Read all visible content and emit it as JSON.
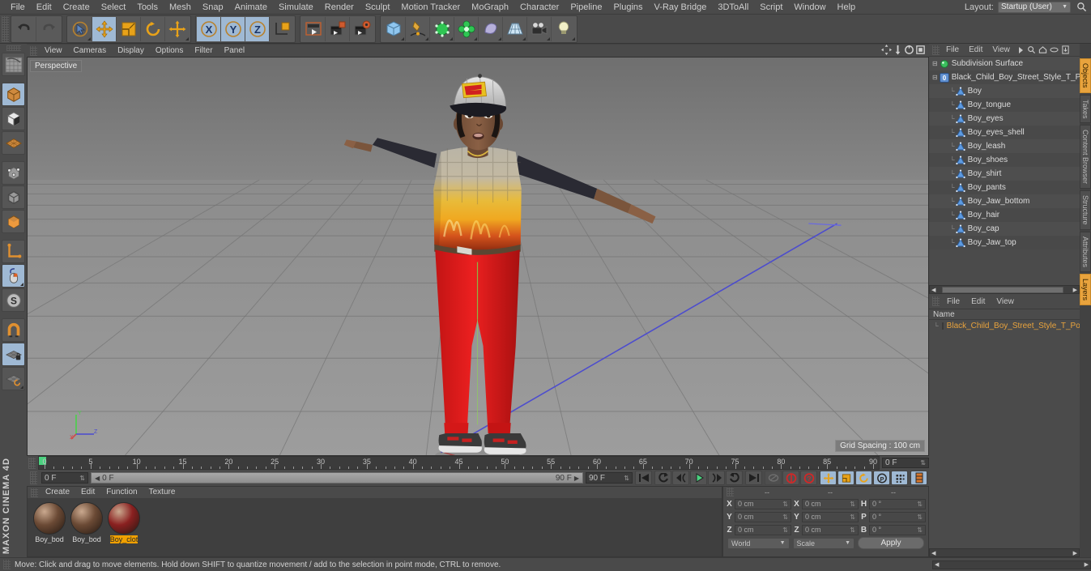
{
  "menubar": {
    "items": [
      "File",
      "Edit",
      "Create",
      "Select",
      "Tools",
      "Mesh",
      "Snap",
      "Animate",
      "Simulate",
      "Render",
      "Sculpt",
      "Motion Tracker",
      "MoGraph",
      "Character",
      "Pipeline",
      "Plugins",
      "V-Ray Bridge",
      "3DToAll",
      "Script",
      "Window",
      "Help"
    ],
    "layout_label": "Layout:",
    "layout_value": "Startup (User)",
    "search_icon": "search-icon"
  },
  "toolbar": {
    "groups": [
      {
        "name": "history",
        "buttons": [
          {
            "name": "undo-button",
            "icon": "undo-icon",
            "state": "normal"
          },
          {
            "name": "redo-button",
            "icon": "redo-icon",
            "state": "disabled"
          }
        ]
      },
      {
        "name": "tools",
        "buttons": [
          {
            "name": "select-tool",
            "icon": "cursor-select-icon",
            "state": "normal"
          },
          {
            "name": "move-tool",
            "icon": "move-arrows-icon",
            "state": "active"
          },
          {
            "name": "scale-tool",
            "icon": "scale-box-icon",
            "state": "normal"
          },
          {
            "name": "rotate-tool",
            "icon": "rotate-circle-icon",
            "state": "normal"
          },
          {
            "name": "combined-tool",
            "icon": "move-plus-icon",
            "state": "normal"
          }
        ]
      },
      {
        "name": "axis-locks",
        "buttons": [
          {
            "name": "lock-x-axis",
            "icon": "x-axis-icon",
            "state": "normal"
          },
          {
            "name": "lock-y-axis",
            "icon": "y-axis-icon",
            "state": "normal"
          },
          {
            "name": "lock-z-axis",
            "icon": "z-axis-icon",
            "state": "normal"
          },
          {
            "name": "world-object-coords",
            "icon": "world-coordinate-icon",
            "state": "normal"
          }
        ]
      },
      {
        "name": "render",
        "buttons": [
          {
            "name": "render-view-button",
            "icon": "render-view-icon",
            "state": "normal"
          },
          {
            "name": "render-to-picture-viewer-button",
            "icon": "render-picture-viewer-icon",
            "state": "normal"
          },
          {
            "name": "render-settings-button",
            "icon": "render-settings-icon",
            "state": "normal"
          }
        ]
      },
      {
        "name": "objects",
        "buttons": [
          {
            "name": "add-cube-button",
            "icon": "cube-icon",
            "state": "normal"
          },
          {
            "name": "add-spline-button",
            "icon": "pen-spline-icon",
            "state": "normal"
          },
          {
            "name": "generators-button",
            "icon": "generator-cube-icon",
            "state": "normal"
          },
          {
            "name": "deformers-button",
            "icon": "deformer-icon",
            "state": "normal"
          },
          {
            "name": "scene-object-button",
            "icon": "environment-icon",
            "state": "normal"
          },
          {
            "name": "floor-object-button",
            "icon": "floor-grid-icon",
            "state": "normal"
          },
          {
            "name": "camera-button",
            "icon": "camera-icon",
            "state": "normal"
          },
          {
            "name": "light-button",
            "icon": "light-bulb-icon",
            "state": "normal"
          }
        ]
      }
    ]
  },
  "leftbar": {
    "buttons": [
      {
        "name": "render-region-tool",
        "icon": "render-region-icon",
        "state": "normal"
      },
      {
        "name": "model-mode",
        "icon": "model-cube-icon",
        "state": "active"
      },
      {
        "name": "texture-mode",
        "icon": "texture-cube-icon",
        "state": "normal"
      },
      {
        "name": "workplane-mode",
        "icon": "workplane-icon",
        "state": "normal"
      },
      {
        "name": "point-mode",
        "icon": "point-mode-icon",
        "state": "normal"
      },
      {
        "name": "edge-mode",
        "icon": "edge-mode-icon",
        "state": "normal"
      },
      {
        "name": "polygon-mode",
        "icon": "polygon-mode-icon",
        "state": "normal"
      },
      {
        "name": "axis-modification-tool",
        "icon": "axis-icon",
        "state": "normal"
      },
      {
        "name": "viewport-solo-tool",
        "icon": "mouse-icon",
        "state": "active"
      },
      {
        "name": "enable-axis-tool",
        "icon": "s-circle-icon",
        "state": "normal"
      },
      {
        "name": "magnet-tool",
        "icon": "magnet-icon",
        "state": "normal"
      },
      {
        "name": "lock-workplane",
        "icon": "workplane-lock-icon",
        "state": "active"
      },
      {
        "name": "planar-workplane",
        "icon": "workplane-rotate-icon",
        "state": "normal"
      }
    ],
    "brand": "MAXON CINEMA 4D"
  },
  "viewport": {
    "menu": [
      "View",
      "Cameras",
      "Display",
      "Options",
      "Filter",
      "Panel"
    ],
    "view_label": "Perspective",
    "grid_spacing": "Grid Spacing : 100 cm",
    "corner_icons": [
      "pan-view-icon",
      "zoom-view-icon",
      "rotate-view-icon",
      "maximize-view-icon"
    ],
    "axis_labels": {
      "x": "X",
      "y": "Y",
      "z": "Z"
    }
  },
  "timeline": {
    "ticks": [
      "0",
      "5",
      "10",
      "15",
      "20",
      "25",
      "30",
      "35",
      "40",
      "45",
      "50",
      "55",
      "60",
      "65",
      "70",
      "75",
      "80",
      "85",
      "90"
    ],
    "min_frame": 0,
    "max_frame": 90,
    "current_frame_field": "0 F",
    "end_frame_field_top": "0 F",
    "scrub_left_label": "0 F",
    "scrub_right_label": "90 F",
    "preview_end_field": "90 F",
    "range_end_field": "90 F",
    "transport": [
      {
        "name": "go-to-start-button",
        "icon": "skip-start-icon"
      },
      {
        "name": "previous-key-button",
        "icon": "prev-key-icon"
      },
      {
        "name": "step-back-button",
        "icon": "step-back-icon"
      },
      {
        "name": "play-button",
        "icon": "play-icon"
      },
      {
        "name": "step-forward-button",
        "icon": "step-forward-icon"
      },
      {
        "name": "next-key-button",
        "icon": "next-key-icon"
      },
      {
        "name": "go-to-end-button",
        "icon": "skip-end-icon"
      },
      {
        "name": "autokey-toggle",
        "icon": "autokey-icon"
      },
      {
        "name": "record-active-objects-button",
        "icon": "record-icon"
      },
      {
        "name": "keyframe-selection-button",
        "icon": "question-key-icon"
      },
      {
        "name": "record-position-toggle",
        "icon": "position-key-icon"
      },
      {
        "name": "record-scale-toggle",
        "icon": "scale-key-icon"
      },
      {
        "name": "record-rotation-toggle",
        "icon": "rotation-key-icon"
      },
      {
        "name": "record-parameter-toggle",
        "icon": "parameter-key-icon"
      },
      {
        "name": "record-pla-toggle",
        "icon": "pla-key-icon"
      },
      {
        "name": "keyframe-layout-button",
        "icon": "timeline-layout-icon"
      }
    ]
  },
  "materials": {
    "menu": [
      "Create",
      "Edit",
      "Function",
      "Texture"
    ],
    "items": [
      {
        "name": "Boy_bod",
        "selected": false,
        "color": "#6b4a35"
      },
      {
        "name": "Boy_bod",
        "selected": false,
        "color": "#6b4a35"
      },
      {
        "name": "Boy_clot",
        "selected": true,
        "color": "#8a2020"
      }
    ]
  },
  "coordinates": {
    "headers": [
      "--",
      "--",
      "--"
    ],
    "rows": [
      {
        "pos_label": "X",
        "pos_value": "0 cm",
        "size_label": "X",
        "size_value": "0 cm",
        "rot_label": "H",
        "rot_value": "0 °"
      },
      {
        "pos_label": "Y",
        "pos_value": "0 cm",
        "size_label": "Y",
        "size_value": "0 cm",
        "rot_label": "P",
        "rot_value": "0 °"
      },
      {
        "pos_label": "Z",
        "pos_value": "0 cm",
        "size_label": "Z",
        "size_value": "0 cm",
        "rot_label": "B",
        "rot_value": "0 °"
      }
    ],
    "system_select": "World",
    "mode_select": "Scale",
    "apply_label": "Apply"
  },
  "object_manager": {
    "menu": [
      "File",
      "Edit",
      "View"
    ],
    "header_icons": [
      "arrow-right-icon",
      "search-icon",
      "home-icon",
      "eye-icon",
      "fit-icon"
    ],
    "tree": [
      {
        "label": "Subdivision Surface",
        "indent": 0,
        "icon": "subdivision-surface-icon",
        "selected": false
      },
      {
        "label": "Black_Child_Boy_Street_Style_T_P",
        "indent": 1,
        "icon": "null-object-icon",
        "selected": false
      },
      {
        "label": "Boy",
        "indent": 2,
        "icon": "polygon-object-icon",
        "selected": false
      },
      {
        "label": "Boy_tongue",
        "indent": 2,
        "icon": "polygon-object-icon",
        "selected": false
      },
      {
        "label": "Boy_eyes",
        "indent": 2,
        "icon": "polygon-object-icon",
        "selected": false
      },
      {
        "label": "Boy_eyes_shell",
        "indent": 2,
        "icon": "polygon-object-icon",
        "selected": false
      },
      {
        "label": "Boy_leash",
        "indent": 2,
        "icon": "polygon-object-icon",
        "selected": false
      },
      {
        "label": "Boy_shoes",
        "indent": 2,
        "icon": "polygon-object-icon",
        "selected": false
      },
      {
        "label": "Boy_shirt",
        "indent": 2,
        "icon": "polygon-object-icon",
        "selected": false
      },
      {
        "label": "Boy_pants",
        "indent": 2,
        "icon": "polygon-object-icon",
        "selected": false
      },
      {
        "label": "Boy_Jaw_bottom",
        "indent": 2,
        "icon": "polygon-object-icon",
        "selected": false
      },
      {
        "label": "Boy_hair",
        "indent": 2,
        "icon": "polygon-object-icon",
        "selected": false
      },
      {
        "label": "Boy_cap",
        "indent": 2,
        "icon": "polygon-object-icon",
        "selected": false
      },
      {
        "label": "Boy_Jaw_top",
        "indent": 2,
        "icon": "polygon-object-icon",
        "selected": false
      }
    ]
  },
  "layer_manager": {
    "menu": [
      "File",
      "Edit",
      "View"
    ],
    "column_header": "Name",
    "rows": [
      {
        "label": "Black_Child_Boy_Street_Style_T_Po",
        "color": "#e07b20"
      }
    ]
  },
  "vertical_tabs": [
    {
      "label": "Objects",
      "active": true
    },
    {
      "label": "Takes",
      "active": false
    },
    {
      "label": "Content Browser",
      "active": false
    },
    {
      "label": "Structure",
      "active": false
    },
    {
      "label": "Attributes",
      "active": false
    },
    {
      "label": "Layers",
      "active": true
    }
  ],
  "statusbar": {
    "message": "Move: Click and drag to move elements. Hold down SHIFT to quantize movement / add to the selection in point mode, CTRL to remove."
  },
  "colors": {
    "accent_orange": "#e8a33d",
    "highlight_blue": "#9fb9d4",
    "panel_bg": "#4a4a4a",
    "viewport_bg": "#8d8d8d",
    "playhead_green": "#4ad17f"
  }
}
